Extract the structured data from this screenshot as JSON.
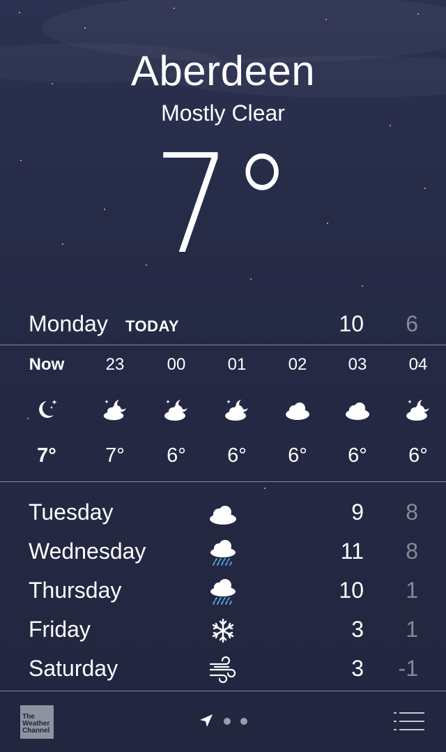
{
  "location": {
    "city": "Aberdeen",
    "condition": "Mostly Clear",
    "temperature": "7°"
  },
  "today": {
    "day": "Monday",
    "label": "TODAY",
    "high": "10",
    "low": "6"
  },
  "hourly": [
    {
      "time": "Now",
      "icon": "moon-stars-icon",
      "temp": "7°"
    },
    {
      "time": "23",
      "icon": "partly-cloudy-night-icon",
      "temp": "7°"
    },
    {
      "time": "00",
      "icon": "partly-cloudy-night-icon",
      "temp": "6°"
    },
    {
      "time": "01",
      "icon": "partly-cloudy-night-icon",
      "temp": "6°"
    },
    {
      "time": "02",
      "icon": "cloud-icon",
      "temp": "6°"
    },
    {
      "time": "03",
      "icon": "cloud-icon",
      "temp": "6°"
    },
    {
      "time": "04",
      "icon": "partly-cloudy-night-icon",
      "temp": "6°"
    }
  ],
  "daily": [
    {
      "day": "Tuesday",
      "icon": "cloud-icon",
      "high": "9",
      "low": "8"
    },
    {
      "day": "Wednesday",
      "icon": "rain-icon",
      "high": "11",
      "low": "8"
    },
    {
      "day": "Thursday",
      "icon": "rain-icon",
      "high": "10",
      "low": "1"
    },
    {
      "day": "Friday",
      "icon": "snowflake-icon",
      "high": "3",
      "low": "1"
    },
    {
      "day": "Saturday",
      "icon": "wind-icon",
      "high": "3",
      "low": "-1"
    }
  ],
  "footer": {
    "logo_text": [
      "The",
      "Weather",
      "Channel"
    ],
    "page_count": 2,
    "current_page_icon": "location-arrow-icon",
    "menu_icon": "list-icon"
  },
  "colors": {
    "background_top": "#2b3150",
    "background_bottom": "#22263f",
    "text": "#ffffff",
    "muted_text": "rgba(255,255,255,0.45)",
    "rain_drops": "#4fa3e0"
  }
}
